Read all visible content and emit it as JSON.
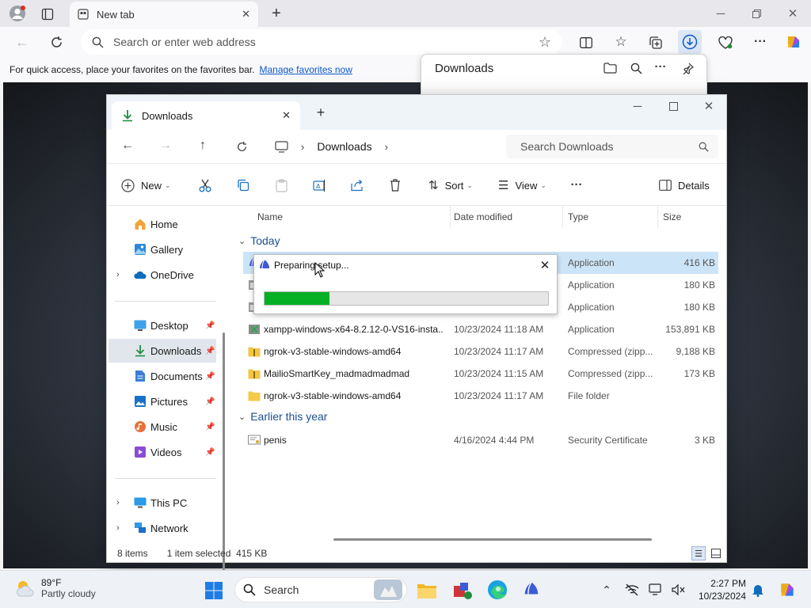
{
  "browser": {
    "tab_title": "New tab",
    "address_placeholder": "Search or enter web address",
    "favbar_text": "For quick access, place your favorites on the favorites bar.",
    "favbar_link": "Manage favorites now",
    "downloads_flyout_title": "Downloads"
  },
  "explorer": {
    "tab_title": "Downloads",
    "breadcrumb": "Downloads",
    "search_placeholder": "Search Downloads",
    "commands": {
      "new": "New",
      "sort": "Sort",
      "view": "View",
      "details": "Details"
    },
    "sidebar": {
      "home": "Home",
      "gallery": "Gallery",
      "onedrive": "OneDrive",
      "desktop": "Desktop",
      "downloads": "Downloads",
      "documents": "Documents",
      "pictures": "Pictures",
      "music": "Music",
      "videos": "Videos",
      "thispc": "This PC",
      "network": "Network"
    },
    "columns": {
      "name": "Name",
      "date": "Date modified",
      "type": "Type",
      "size": "Size"
    },
    "groups": {
      "today": "Today",
      "earlier": "Earlier this year"
    },
    "files": [
      {
        "name": "",
        "date": "",
        "type": "Application",
        "size": "416 KB"
      },
      {
        "name": "",
        "date": "",
        "type": "Application",
        "size": "180 KB"
      },
      {
        "name": "",
        "date": "",
        "type": "Application",
        "size": "180 KB"
      },
      {
        "name": "xampp-windows-x64-8.2.12-0-VS16-insta...",
        "date": "10/23/2024 11:18 AM",
        "type": "Application",
        "size": "153,891 KB"
      },
      {
        "name": "ngrok-v3-stable-windows-amd64",
        "date": "10/23/2024 11:17 AM",
        "type": "Compressed (zipp...",
        "size": "9,188 KB"
      },
      {
        "name": "MailioSmartKey_madmadmadmad",
        "date": "10/23/2024 11:15 AM",
        "type": "Compressed (zipp...",
        "size": "173 KB"
      },
      {
        "name": "ngrok-v3-stable-windows-amd64",
        "date": "10/23/2024 11:17 AM",
        "type": "File folder",
        "size": ""
      },
      {
        "name": "penis",
        "date": "4/16/2024 4:44 PM",
        "type": "Security Certificate",
        "size": "3 KB"
      }
    ],
    "status": {
      "items": "8 items",
      "selected": "1 item selected  415 KB"
    }
  },
  "setup_dialog": {
    "title": "Preparing setup...",
    "progress": 0.23
  },
  "taskbar": {
    "temperature": "89°F",
    "condition": "Partly cloudy",
    "search_label": "Search",
    "time": "2:27 PM",
    "date": "10/23/2024"
  }
}
